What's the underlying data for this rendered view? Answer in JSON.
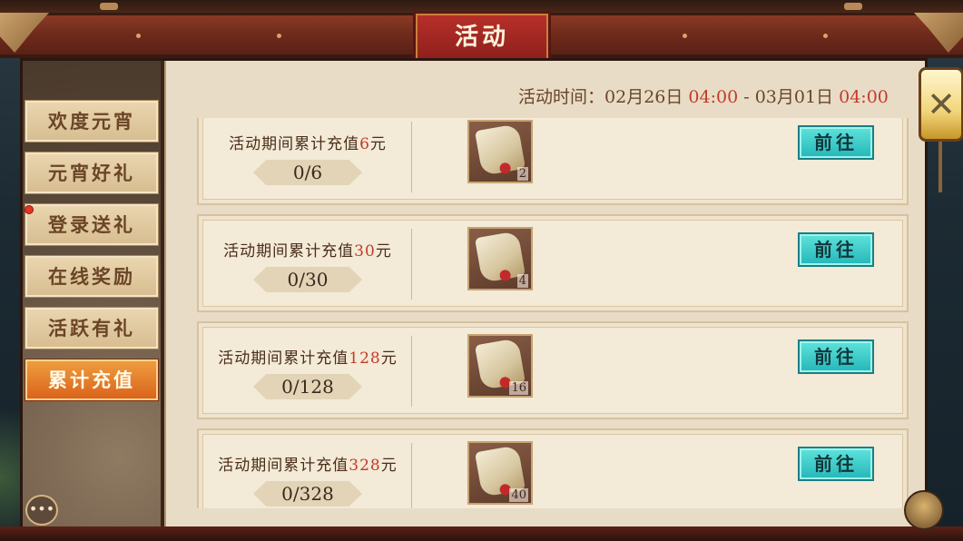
{
  "header": {
    "title": "活动"
  },
  "sidebar": {
    "tabs": [
      {
        "label": "欢度元宵",
        "active": false
      },
      {
        "label": "元宵好礼",
        "active": false
      },
      {
        "label": "登录送礼",
        "active": false,
        "badge": true
      },
      {
        "label": "在线奖励",
        "active": false
      },
      {
        "label": "活跃有礼",
        "active": false
      },
      {
        "label": "累计充值",
        "active": true
      }
    ]
  },
  "event_time": {
    "label": "活动时间：",
    "start_date": "02月26日",
    "start_time": "04:00",
    "separator": "-",
    "end_date": "03月01日",
    "end_time": "04:00"
  },
  "rewards": [
    {
      "prefix": "活动期间累计充值",
      "amount": "6",
      "unit": "元",
      "progress": "0/6",
      "item_count": "2",
      "button": "前往"
    },
    {
      "prefix": "活动期间累计充值",
      "amount": "30",
      "unit": "元",
      "progress": "0/30",
      "item_count": "4",
      "button": "前往"
    },
    {
      "prefix": "活动期间累计充值",
      "amount": "128",
      "unit": "元",
      "progress": "0/128",
      "item_count": "16",
      "button": "前往"
    },
    {
      "prefix": "活动期间累计充值",
      "amount": "328",
      "unit": "元",
      "progress": "0/328",
      "item_count": "40",
      "button": "前往"
    }
  ],
  "controls": {
    "close_symbol": "✕",
    "chat_symbol": "•••"
  },
  "colors": {
    "accent_red": "#c33b2a",
    "go_button": "#24b6b8",
    "active_tab": "#d9601a"
  },
  "icons": [
    "close-icon",
    "chat-icon",
    "gourd-icon",
    "red-envelope-icon"
  ]
}
